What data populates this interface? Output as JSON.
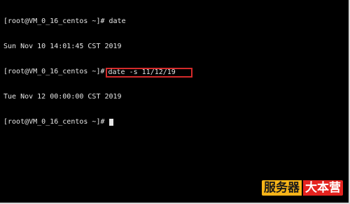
{
  "terminal": {
    "lines": [
      {
        "prompt": "[root@VM_0_16_centos ~]# ",
        "command": "date"
      },
      {
        "output": "Sun Nov 10 14:01:45 CST 2019"
      },
      {
        "prompt": "[root@VM_0_16_centos ~]#",
        "command": "date -s 11/12/19"
      },
      {
        "output": "Tue Nov 12 00:00:00 CST 2019"
      },
      {
        "prompt": "[root@VM_0_16_centos ~]# "
      }
    ],
    "highlight_color": "#d42a2a"
  },
  "watermark": {
    "left": "服务器",
    "right": "大本营",
    "left_color": "#f7b418",
    "right_color": "#e5231f"
  }
}
